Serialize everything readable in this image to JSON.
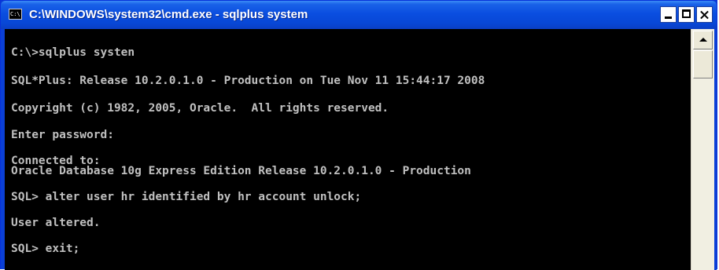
{
  "window": {
    "title": "C:\\WINDOWS\\system32\\cmd.exe - sqlplus system",
    "icon": "cmd-icon",
    "icon_text": "C:\\"
  },
  "console": {
    "lines": [
      "C:\\>sqlplus systen",
      "SQL*Plus: Release 10.2.0.1.0 - Production on Tue Nov 11 15:44:17 2008",
      "Copyright (c) 1982, 2005, Oracle.  All rights reserved.",
      "Enter password:",
      "Connected to:",
      "Oracle Database 10g Express Edition Release 10.2.0.1.0 - Production",
      "SQL> alter user hr identified by hr account unlock;",
      "User altered.",
      "SQL> exit;"
    ]
  },
  "colors": {
    "titlebar": "#0a4ee0",
    "console_background": "#000000",
    "console_text": "#c0c0c0"
  }
}
